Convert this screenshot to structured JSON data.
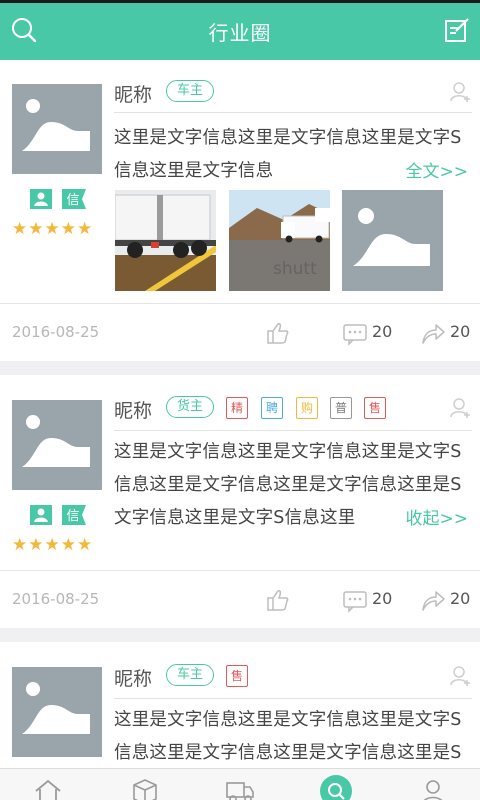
{
  "header": {
    "title": "行业圈"
  },
  "posts": [
    {
      "nickname": "昵称",
      "role": "车主",
      "badge_person": "人",
      "badge_verified": "信",
      "stars": "★★★★★",
      "text": "这里是文字信息这里是文字信息这里是文字S信息这里是文字信息",
      "more_label": "全文>>",
      "date": "2016-08-25",
      "comments": "20",
      "shares": "20"
    },
    {
      "nickname": "昵称",
      "role": "货主",
      "tags": [
        "精",
        "聘",
        "购",
        "普",
        "售"
      ],
      "badge_person": "人",
      "badge_verified": "信",
      "stars": "★★★★★",
      "text": "这里是文字信息这里是文字信息这里是文字S信息这里是文字信息这里是文字信息这里是S文字信息这里是文字S信息这里",
      "more_label": "收起>>",
      "date": "2016-08-25",
      "comments": "20",
      "shares": "20"
    },
    {
      "nickname": "昵称",
      "role": "车主",
      "tags": [
        "售"
      ],
      "text": "这里是文字信息这里是文字信息这里是文字S信息这里是文字信息这里是文字信息这里是S"
    }
  ],
  "thumbnail_caption": "shutt",
  "colors": {
    "accent": "#48c8a6",
    "tag_jing": "#e15a5a",
    "tag_pin": "#4aa9e6",
    "tag_gou": "#f0b93c",
    "tag_pu": "#777777",
    "tag_shou": "#e15a5a",
    "star": "#f3b73a"
  },
  "tabbar": [
    "home-icon",
    "package-icon",
    "truck-icon",
    "circle-search-icon",
    "profile-icon"
  ]
}
